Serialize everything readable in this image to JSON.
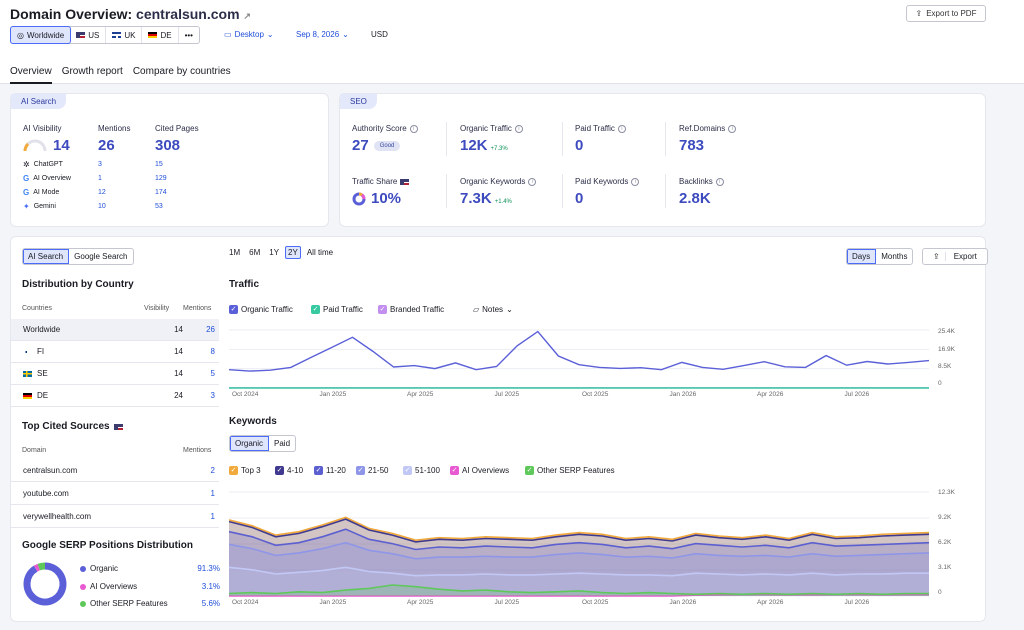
{
  "header": {
    "title_prefix": "Domain Overview:",
    "domain": "centralsun.com",
    "export_pdf": "Export to PDF",
    "locations": [
      {
        "label": "Worldwide",
        "active": true
      },
      {
        "label": "US",
        "active": false
      },
      {
        "label": "UK",
        "active": false
      },
      {
        "label": "DE",
        "active": false
      },
      {
        "label": "•••",
        "active": false
      }
    ],
    "device": "Desktop",
    "date": "Sep 8, 2026",
    "currency": "USD"
  },
  "tabs": [
    "Overview",
    "Growth report",
    "Compare by countries"
  ],
  "ai_card": {
    "pill": "AI Search",
    "visibility_label": "AI Visibility",
    "visibility_value": "14",
    "mentions_label": "Mentions",
    "mentions_value": "26",
    "cited_label": "Cited Pages",
    "cited_value": "308",
    "rows": [
      {
        "name": "ChatGPT",
        "mentions": "3",
        "cited": "15"
      },
      {
        "name": "AI Overview",
        "mentions": "1",
        "cited": "129"
      },
      {
        "name": "AI Mode",
        "mentions": "12",
        "cited": "174"
      },
      {
        "name": "Gemini",
        "mentions": "10",
        "cited": "53"
      }
    ]
  },
  "seo_card": {
    "pill": "SEO",
    "authority_label": "Authority Score",
    "authority_value": "27",
    "authority_badge": "Good",
    "organic_traffic_label": "Organic Traffic",
    "organic_traffic_value": "12K",
    "organic_traffic_delta": "+7.3%",
    "paid_traffic_label": "Paid Traffic",
    "paid_traffic_value": "0",
    "ref_domains_label": "Ref.Domains",
    "ref_domains_value": "783",
    "traffic_share_label": "Traffic Share",
    "traffic_share_value": "10%",
    "organic_kw_label": "Organic Keywords",
    "organic_kw_value": "7.3K",
    "organic_kw_delta": "+1.4%",
    "paid_kw_label": "Paid Keywords",
    "paid_kw_value": "0",
    "backlinks_label": "Backlinks",
    "backlinks_value": "2.8K"
  },
  "left_panel": {
    "toggle": [
      "AI Search",
      "Google Search"
    ],
    "dist_title": "Distribution by Country",
    "dist_headers": [
      "Countries",
      "Visibility",
      "Mentions"
    ],
    "dist_rows": [
      {
        "country": "Worldwide",
        "visibility": "14",
        "mentions": "26"
      },
      {
        "country": "FI",
        "visibility": "14",
        "mentions": "8"
      },
      {
        "country": "SE",
        "visibility": "14",
        "mentions": "5"
      },
      {
        "country": "DE",
        "visibility": "24",
        "mentions": "3"
      }
    ],
    "sources_title": "Top Cited Sources",
    "sources_headers": [
      "Domain",
      "Mentions"
    ],
    "sources_rows": [
      {
        "domain": "centralsun.com",
        "mentions": "2"
      },
      {
        "domain": "youtube.com",
        "mentions": "1"
      },
      {
        "domain": "verywellhealth.com",
        "mentions": "1"
      }
    ],
    "serp_title": "Google SERP Positions Distribution",
    "serp_rows": [
      {
        "name": "Organic",
        "value": "91.3%",
        "color": "#5b60d8",
        "pct": 91.3
      },
      {
        "name": "AI Overviews",
        "value": "3.1%",
        "color": "#e85ad1",
        "pct": 3.1
      },
      {
        "name": "Other SERP Features",
        "value": "5.6%",
        "color": "#5ec85a",
        "pct": 5.6
      }
    ]
  },
  "traffic_panel": {
    "ranges": [
      "1M",
      "6M",
      "1Y",
      "2Y",
      "All time"
    ],
    "active_range": "2Y",
    "granularity": [
      "Days",
      "Months"
    ],
    "export": "Export",
    "title": "Traffic",
    "legend": [
      {
        "name": "Organic Traffic",
        "color": "#5b60d8"
      },
      {
        "name": "Paid Traffic",
        "color": "#37c9a0"
      },
      {
        "name": "Branded Traffic",
        "color": "#c28ef0"
      }
    ],
    "notes": "Notes",
    "y_ticks": [
      "25.4K",
      "16.9K",
      "8.5K",
      "0"
    ],
    "x_ticks": [
      "Oct 2024",
      "Jan 2025",
      "Apr 2025",
      "Jul 2025",
      "Oct 2025",
      "Jan 2026",
      "Apr 2026",
      "Jul 2026"
    ]
  },
  "keywords_panel": {
    "title": "Keywords",
    "toggle": [
      "Organic",
      "Paid"
    ],
    "legend": [
      {
        "name": "Top 3",
        "color": "#f2a93b"
      },
      {
        "name": "4-10",
        "color": "#3f3a8f"
      },
      {
        "name": "11-20",
        "color": "#5b5fd0"
      },
      {
        "name": "21-50",
        "color": "#8f96e8"
      },
      {
        "name": "51-100",
        "color": "#c2c8f6"
      },
      {
        "name": "AI Overviews",
        "color": "#e85ad1"
      },
      {
        "name": "Other SERP Features",
        "color": "#5ec85a"
      }
    ],
    "y_ticks": [
      "12.3K",
      "9.2K",
      "6.2K",
      "3.1K",
      "0"
    ],
    "x_ticks": [
      "Oct 2024",
      "Jan 2025",
      "Apr 2025",
      "Jul 2025",
      "Oct 2025",
      "Jan 2026",
      "Apr 2026",
      "Jul 2026"
    ]
  },
  "chart_data": [
    {
      "type": "line",
      "title": "Traffic",
      "ylim": [
        0,
        25400
      ],
      "x": [
        "Oct 2024",
        "Jan 2025",
        "Apr 2025",
        "Jul 2025",
        "Oct 2025",
        "Jan 2026",
        "Apr 2026",
        "Jul 2026"
      ],
      "series": [
        {
          "name": "Organic Traffic",
          "values": [
            8000,
            7400,
            7800,
            9000,
            13500,
            17800,
            22200,
            16000,
            9200,
            9800,
            8500,
            11000,
            8000,
            9400,
            18500,
            24700,
            14000,
            10200,
            9000,
            8600,
            8900,
            8000,
            11200,
            9000,
            8200,
            9800,
            11500,
            9300,
            9000,
            14200,
            10000,
            11600,
            10500,
            11200,
            12000
          ]
        },
        {
          "name": "Paid Traffic",
          "values": [
            0,
            0,
            0,
            0,
            0,
            0,
            0,
            0,
            0,
            0,
            0,
            0,
            0,
            0,
            0,
            0,
            0,
            0,
            0,
            0,
            0,
            0,
            0,
            0,
            0,
            0,
            0,
            0,
            0,
            0,
            0,
            0,
            0,
            0,
            0
          ]
        },
        {
          "name": "Branded Traffic",
          "values": [
            100,
            100,
            100,
            100,
            100,
            100,
            100,
            100,
            100,
            100,
            100,
            100,
            100,
            100,
            100,
            100,
            100,
            100,
            100,
            100,
            100,
            100,
            100,
            100,
            100,
            100,
            100,
            100,
            100,
            100,
            100,
            100,
            100,
            100,
            100
          ]
        }
      ]
    },
    {
      "type": "area",
      "title": "Keywords",
      "ylim": [
        0,
        12300
      ],
      "x": [
        "Oct 2024",
        "Jan 2025",
        "Apr 2025",
        "Jul 2025",
        "Oct 2025",
        "Jan 2026",
        "Apr 2026",
        "Jul 2026"
      ],
      "series": [
        {
          "name": "Top 3",
          "values": [
            9000,
            8300,
            7200,
            7600,
            8400,
            9300,
            8000,
            7400,
            6600,
            6900,
            6800,
            7000,
            6900,
            6800,
            7200,
            7500,
            7300,
            6800,
            7000,
            6700,
            7400,
            7100,
            6900,
            7200,
            6800,
            7500,
            7000,
            7100,
            7300,
            7400,
            7500
          ]
        },
        {
          "name": "4-10",
          "values": [
            8800,
            8100,
            7000,
            7400,
            8200,
            9100,
            7800,
            7200,
            6400,
            6700,
            6600,
            6800,
            6700,
            6600,
            7000,
            7300,
            7100,
            6600,
            6800,
            6500,
            7200,
            6900,
            6700,
            7000,
            6600,
            7300,
            6800,
            6900,
            7100,
            7200,
            7300
          ]
        },
        {
          "name": "11-20",
          "values": [
            7600,
            7000,
            6000,
            6300,
            7000,
            7900,
            6700,
            6200,
            5500,
            5800,
            5700,
            5900,
            5800,
            5700,
            6100,
            6300,
            6100,
            5700,
            5900,
            5600,
            6200,
            6000,
            5800,
            6000,
            5700,
            6300,
            5900,
            6000,
            6100,
            6200,
            6300
          ]
        },
        {
          "name": "21-50",
          "values": [
            6100,
            5600,
            4800,
            5100,
            5600,
            6300,
            5400,
            5000,
            4400,
            4600,
            4600,
            4700,
            4600,
            4600,
            4900,
            5100,
            4900,
            4600,
            4700,
            4500,
            5000,
            4800,
            4700,
            4800,
            4600,
            5000,
            4700,
            4800,
            4900,
            5000,
            5100
          ]
        },
        {
          "name": "51-100",
          "values": [
            3400,
            3100,
            2600,
            2800,
            3000,
            3400,
            2900,
            2700,
            2400,
            2500,
            2500,
            2600,
            2500,
            2500,
            2600,
            2700,
            2600,
            2500,
            2500,
            2400,
            2700,
            2600,
            2500,
            2600,
            2500,
            2700,
            2500,
            2600,
            2600,
            2700,
            2700
          ]
        },
        {
          "name": "AI Overviews",
          "values": [
            0,
            0,
            0,
            0,
            0,
            0,
            0,
            0,
            0,
            0,
            0,
            0,
            0,
            0,
            0,
            0,
            0,
            0,
            0,
            0,
            100,
            150,
            200,
            200,
            150,
            150,
            200,
            200,
            150,
            200,
            200
          ]
        },
        {
          "name": "Other SERP Features",
          "values": [
            300,
            400,
            300,
            500,
            400,
            700,
            900,
            1300,
            1100,
            800,
            600,
            700,
            500,
            400,
            500,
            600,
            400,
            300,
            400,
            300,
            200,
            300,
            200,
            300,
            200,
            300,
            200,
            300,
            200,
            300,
            300
          ]
        }
      ]
    },
    {
      "type": "pie",
      "title": "Google SERP Positions Distribution",
      "categories": [
        "Organic",
        "AI Overviews",
        "Other SERP Features"
      ],
      "values": [
        91.3,
        3.1,
        5.6
      ]
    }
  ]
}
